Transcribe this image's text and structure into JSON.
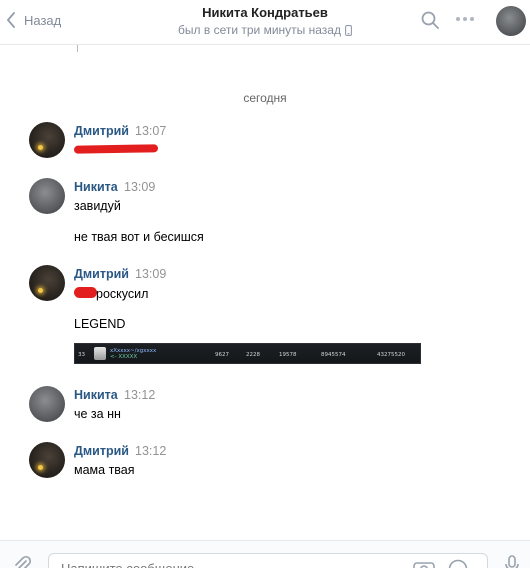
{
  "header": {
    "back_label": "Назад",
    "name": "Никита Кондратьев",
    "status": "был в сети три минуты назад"
  },
  "date_separator": "сегодня",
  "messages": [
    {
      "author": "Дмитрий",
      "time": "13:07",
      "texts": [
        ""
      ]
    },
    {
      "author": "Никита",
      "time": "13:09",
      "texts": [
        "завидуй",
        "не твая вот и бесишся"
      ]
    },
    {
      "author": "Дмитрий",
      "time": "13:09",
      "texts": [
        "роскусил",
        "LEGEND"
      ]
    },
    {
      "author": "Никита",
      "time": "13:12",
      "texts": [
        "че за нн"
      ]
    },
    {
      "author": "Дмитрий",
      "time": "13:12",
      "texts": [
        "мама твая"
      ]
    }
  ],
  "legend_screenshot": {
    "rank": "33",
    "nick_line1": "xXxxxx~/xgxxxx",
    "nick_line2": "<- XXXXX",
    "stats": [
      "9627",
      "2228",
      "19578",
      "8945574",
      "43275520"
    ]
  },
  "composer": {
    "placeholder": "Напишите сообщение..."
  },
  "colors": {
    "author": "#2a5885",
    "secondary_text": "#828a99",
    "redaction": "#e21e1e"
  }
}
